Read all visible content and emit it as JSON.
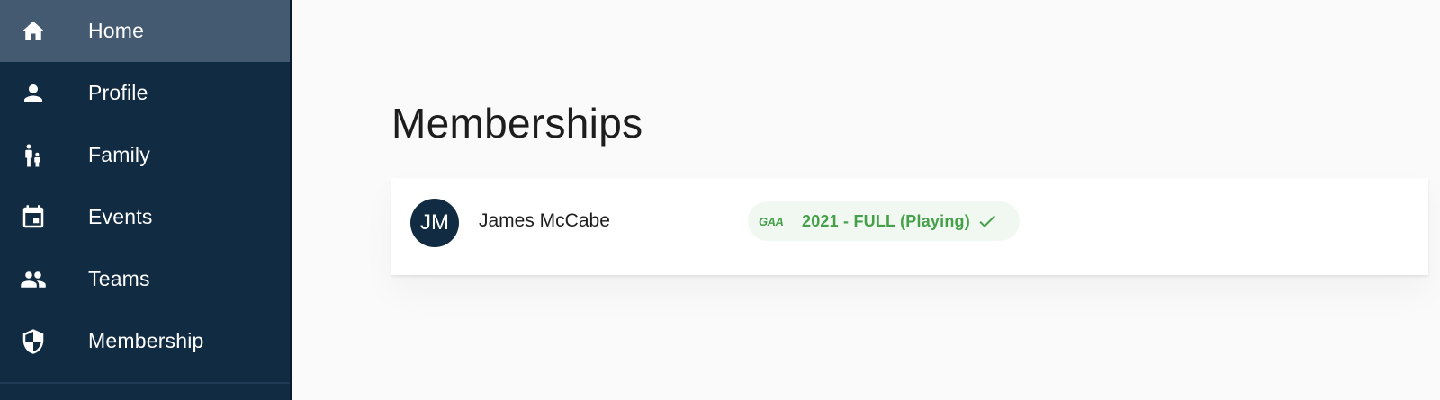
{
  "sidebar": {
    "items": [
      {
        "label": "Home",
        "icon": "home-icon",
        "active": true
      },
      {
        "label": "Profile",
        "icon": "person-icon",
        "active": false
      },
      {
        "label": "Family",
        "icon": "family-icon",
        "active": false
      },
      {
        "label": "Events",
        "icon": "calendar-icon",
        "active": false
      },
      {
        "label": "Teams",
        "icon": "people-icon",
        "active": false
      },
      {
        "label": "Membership",
        "icon": "shield-icon",
        "active": false
      }
    ]
  },
  "main": {
    "title": "Memberships",
    "memberships": [
      {
        "initials": "JM",
        "name": "James McCabe",
        "logo_text": "GAA",
        "status_label": "2021 - FULL (Playing)",
        "status_icon": "check-icon"
      }
    ]
  },
  "colors": {
    "sidebar_bg": "#112b42",
    "sidebar_active": "#435a71",
    "status_green": "#45a049",
    "chip_bg": "#f1f8f1"
  }
}
